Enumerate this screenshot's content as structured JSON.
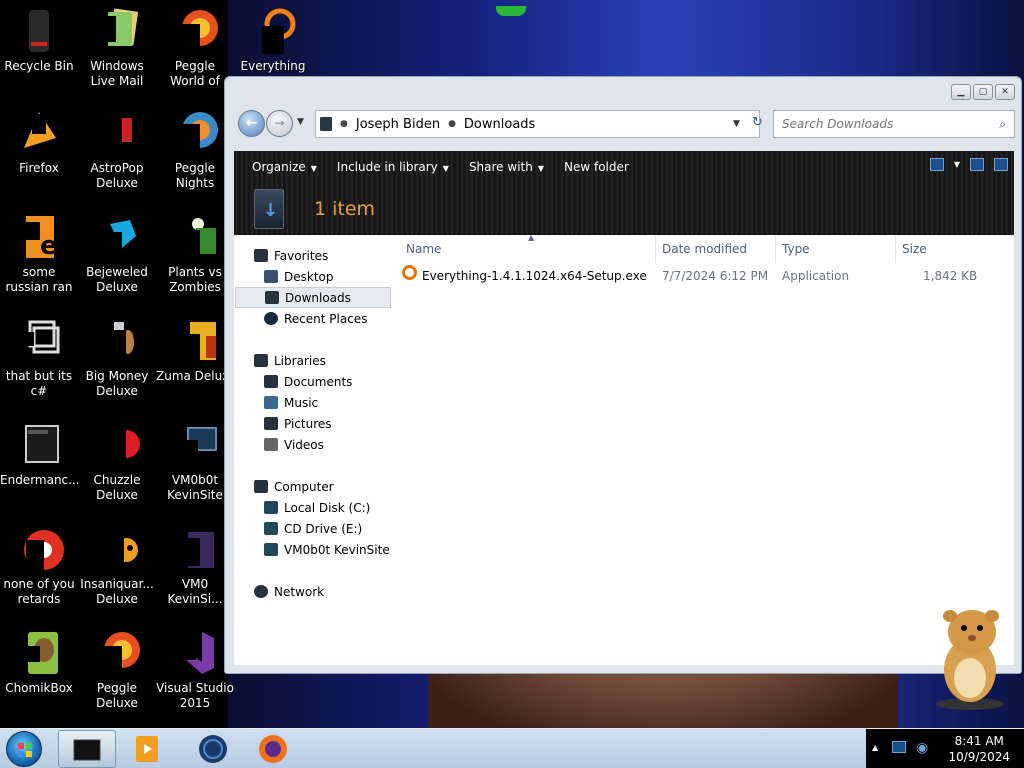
{
  "desktop": {
    "icons": [
      {
        "label": "Recycle Bin",
        "icon": "recycle-bin-icon"
      },
      {
        "label": "Windows Live Mail",
        "icon": "mail-icon"
      },
      {
        "label": "Peggle World of Warcraft ...",
        "icon": "peggle-icon"
      },
      {
        "label": "Everything",
        "icon": "everything-search-icon"
      },
      {
        "label": "Firefox",
        "icon": "firefox-icon"
      },
      {
        "label": "AstroPop Deluxe",
        "icon": "astropop-icon"
      },
      {
        "label": "Peggle Nights Deluxe",
        "icon": "peggle-nights-icon"
      },
      {
        "label": "some russian ran a rat",
        "icon": "russian-e-icon"
      },
      {
        "label": "Bejeweled Deluxe",
        "icon": "bejeweled-icon"
      },
      {
        "label": "Plants vs Zombies",
        "icon": "plants-vs-zombies-icon"
      },
      {
        "label": "that but its c#",
        "icon": "shortcut-windows-icon"
      },
      {
        "label": "Big Money Deluxe",
        "icon": "big-money-icon"
      },
      {
        "label": "Zuma Deluxe",
        "icon": "zuma-icon"
      },
      {
        "label": "Endermanc...",
        "icon": "app-window-icon"
      },
      {
        "label": "Chuzzle Deluxe",
        "icon": "chuzzle-icon"
      },
      {
        "label": "VM0b0t KevinSite",
        "icon": "vm-icon"
      },
      {
        "label": "none of you retards kno...",
        "icon": "chrome-icon"
      },
      {
        "label": "Insaniquar... Deluxe",
        "icon": "insaniquarium-icon"
      },
      {
        "label": "VM0 KevinSi...",
        "icon": "vm-icon"
      },
      {
        "label": "ChomikBox",
        "icon": "chomikbox-icon"
      },
      {
        "label": "Peggle Deluxe",
        "icon": "peggle-deluxe-icon"
      },
      {
        "label": "Visual Studio 2015",
        "icon": "visual-studio-icon"
      }
    ]
  },
  "explorer": {
    "breadcrumb": [
      "Joseph Biden",
      "Downloads"
    ],
    "search_placeholder": "Search Downloads",
    "toolbar": {
      "organize": "Organize",
      "include_in_library": "Include in library",
      "share_with": "Share with",
      "new_folder": "New folder"
    },
    "item_count": "1 item",
    "nav": {
      "favorites": "Favorites",
      "desktop": "Desktop",
      "downloads": "Downloads",
      "recent_places": "Recent Places",
      "libraries": "Libraries",
      "documents": "Documents",
      "music": "Music",
      "pictures": "Pictures",
      "videos": "Videos",
      "computer": "Computer",
      "local_disk": "Local Disk (C:)",
      "cd_drive": "CD Drive (E:)",
      "vm_share": "VM0b0t KevinSite",
      "network": "Network"
    },
    "columns": {
      "name": "Name",
      "date_modified": "Date modified",
      "type": "Type",
      "size": "Size"
    },
    "files": [
      {
        "name": "Everything-1.4.1.1024.x64-Setup.exe",
        "date": "7/7/2024 6:12 PM",
        "type": "Application",
        "size": "1,842 KB"
      }
    ]
  },
  "taskbar": {
    "time": "8:41 AM",
    "date": "10/9/2024"
  },
  "colors": {
    "accent_orange": "#e8a040",
    "taskbar": "#b7cce2"
  }
}
